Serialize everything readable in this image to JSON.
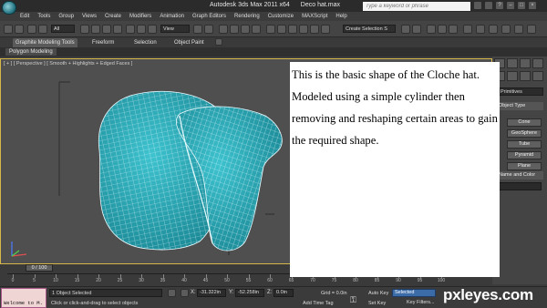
{
  "title": {
    "app": "Autodesk 3ds Max  2011 x64",
    "file": "Deco hat.max"
  },
  "search": {
    "placeholder": "Type a keyword or phrase"
  },
  "menu": [
    "Edit",
    "Tools",
    "Group",
    "Views",
    "Create",
    "Modifiers",
    "Animation",
    "Graph Editors",
    "Rendering",
    "Customize",
    "MAXScript",
    "Help"
  ],
  "toolbar": {
    "filter": "All",
    "ref_coord": "View",
    "selection_set": "Create Selection S"
  },
  "ribbon": {
    "tabs": [
      "Graphite Modeling Tools",
      "Freeform",
      "Selection",
      "Object Paint"
    ],
    "sub_panel": "Polygon Modeling"
  },
  "viewport": {
    "label": "[ + ] [ Perspective ] [ Smooth + Highlights + Edged Faces ]",
    "mesh_color": "#22a7b4",
    "wire_color": "#e9fbff"
  },
  "note": {
    "text": "This is the basic shape of the Cloche hat. Modeled using a simple cylinder then removing and reshaping certain areas to gain the required shape."
  },
  "command_panel": {
    "object_type_dropdown": "Primitives",
    "rollout_title": "Object Type",
    "buttons": [
      "Cone",
      "GeoSphere",
      "Tube",
      "Pyramid",
      "Plane"
    ],
    "name_color_rollout": "Name and Color"
  },
  "timeline": {
    "slider": "0 / 100",
    "ticks": [
      "0",
      "5",
      "10",
      "15",
      "20",
      "25",
      "30",
      "35",
      "40",
      "45",
      "50",
      "55",
      "60",
      "65",
      "70",
      "75",
      "80",
      "85",
      "90",
      "95",
      "100"
    ]
  },
  "status": {
    "listener": "Welcome to M.",
    "selected": "1 Object Selected",
    "prompt": "Click or click-and-drag to select objects",
    "x": "-31.322in",
    "y": "-52.258in",
    "z": "0.0in",
    "grid": "Grid = 0.0in",
    "add_time_tag": "Add Time Tag",
    "auto_key": "Auto Key",
    "auto_key_mode": "Selected",
    "set_key": "Set Key",
    "key_filters": "Key Filters..."
  },
  "watermark": "pxleyes.com"
}
